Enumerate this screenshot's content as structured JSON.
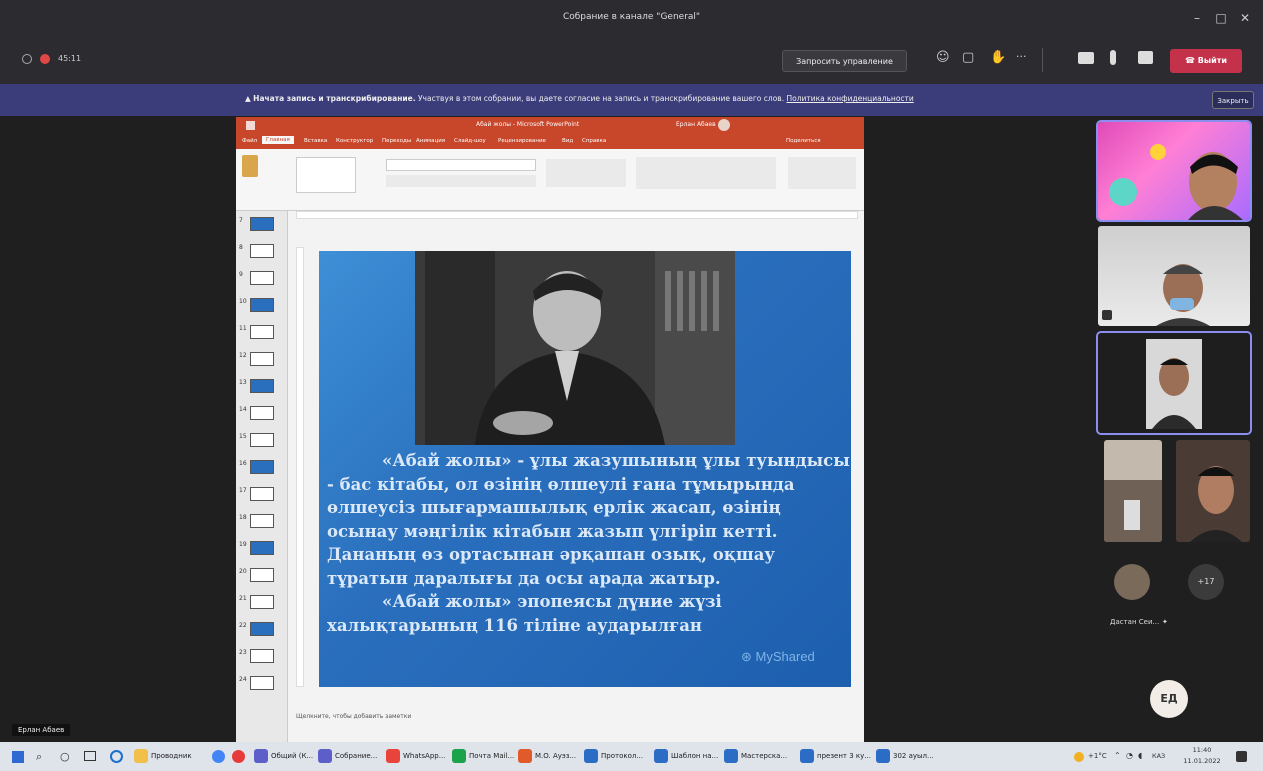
{
  "window": {
    "title": "Собрание в канале \"General\"",
    "minimize": "–",
    "maximize": "□",
    "close": "✕"
  },
  "toolbar": {
    "timer": "45:11",
    "request_control": "Запросить управление",
    "leave": "Выйти",
    "more": "···"
  },
  "banner": {
    "text_bold": "Начата запись и транскрибирование.",
    "text": "Участвуя в этом собрании, вы даете согласие на запись и транскрибирование вашего слов.",
    "link": "Политика конфиденциальности",
    "close": "Закрыть"
  },
  "ppt": {
    "title": "Абай жолы - Microsoft PowerPoint",
    "user": "Ерлан Абаев",
    "tabs": [
      "Файл",
      "Главная",
      "Вставка",
      "Конструктор",
      "Переходы",
      "Анимация",
      "Слайд-шоу",
      "Рецензирование",
      "Вид",
      "Справка",
      "Поделиться"
    ],
    "thumb_numbers": [
      "7",
      "8",
      "9",
      "10",
      "11",
      "12",
      "13",
      "14",
      "15",
      "16",
      "17",
      "18",
      "19",
      "20",
      "21",
      "22",
      "23",
      "24"
    ],
    "notes": "Щелкните, чтобы добавить заметки",
    "slide_text_1": "«Абай жолы» - ұлы жазушының ұлы туындысы - бас кітабы, ол өзінің өлшеулі ғана тұмырында өлшеусіз шығармашылық ерлік жасап, өзінің осынау мәңгілік кітабын жазып үлгіріп кетті. Дананың өз ортасынан әрқашан озық, оқшау тұратын даралығы да осы арада жатыр.",
    "slide_text_2": "«Абай жолы» эпопеясы дүние жүзі халықтарының 116 тіліне аударылған",
    "watermark": "MyShared"
  },
  "participants": {
    "more_count": "+17",
    "named": "Дастан Сеи...",
    "initials": "ЕД",
    "presenter_label": "Ерлан Абаев"
  },
  "taskbar": {
    "items": [
      "Проводник",
      "Общий (К...",
      "Собрание...",
      "WhatsApp...",
      "Почта Mail...",
      "M.O. Ауэз...",
      "Протокол...",
      "Шаблон на...",
      "Мастерска...",
      "презент 3 ку...",
      "302 ауыл..."
    ],
    "temp": "+1°C",
    "lang": "КАЗ",
    "time": "11:40",
    "date": "11.01.2022"
  },
  "colors": {
    "teams_bg": "#1f1f1f",
    "banner": "#3b3d7a",
    "leave": "#c4314b",
    "ppt_accent": "#c8462a",
    "slide_blue": "#2a6fbd"
  }
}
